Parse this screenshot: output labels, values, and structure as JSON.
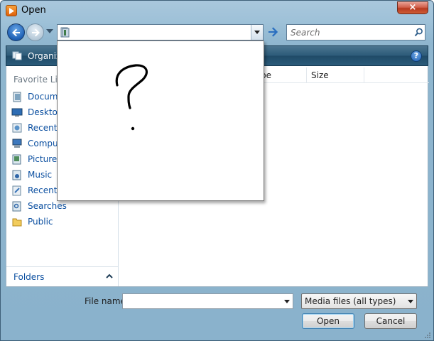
{
  "window": {
    "title": "Open"
  },
  "titlebar": {
    "close_glyph": "×"
  },
  "search": {
    "placeholder": "Search"
  },
  "toolbar": {
    "organize": "Organize",
    "help_glyph": "?"
  },
  "nav_pane": {
    "header": "Favorite Lin",
    "items": [
      {
        "label": "Docume",
        "icon": "documents-icon"
      },
      {
        "label": "Desktop",
        "icon": "desktop-icon"
      },
      {
        "label": "Recent P",
        "icon": "recent-places-icon"
      },
      {
        "label": "Comput",
        "icon": "computer-icon"
      },
      {
        "label": "Pictures",
        "icon": "pictures-icon"
      },
      {
        "label": "Music",
        "icon": "music-icon"
      },
      {
        "label": "Recently",
        "icon": "recently-changed-icon"
      },
      {
        "label": "Searches",
        "icon": "searches-icon"
      },
      {
        "label": "Public",
        "icon": "public-folder-icon"
      }
    ],
    "folders": "Folders"
  },
  "file_list": {
    "columns": [
      "pe",
      "Size"
    ]
  },
  "bottom": {
    "filename_label": "File name:",
    "filename_value": "",
    "filetype": "Media files (all types)",
    "open": "Open",
    "cancel": "Cancel"
  }
}
